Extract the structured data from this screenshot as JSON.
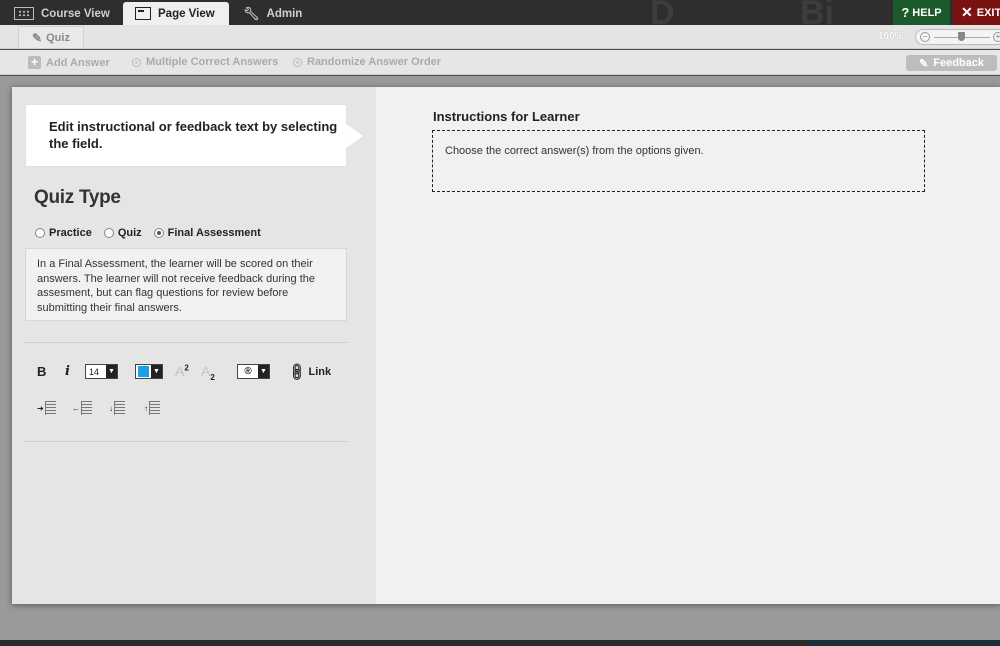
{
  "topnav": {
    "tabs": [
      {
        "label": "Course View",
        "icon": "grid-icon"
      },
      {
        "label": "Page View",
        "icon": "page-icon",
        "active": true
      },
      {
        "label": "Admin",
        "icon": "wrench-icon"
      }
    ],
    "help_label": "HELP",
    "exit_label": "EXIT",
    "help_color": "#1c5a2b",
    "exit_color": "#7a1212"
  },
  "subbar": {
    "page_tab_label": "Quiz",
    "zoom_label": "100%",
    "zoom_level_percent": 100
  },
  "toolbar": {
    "add_answer": "Add Answer",
    "multiple_correct": "Multiple Correct Answers",
    "randomize": "Randomize Answer Order",
    "feedback": "Feedback"
  },
  "editor": {
    "callout_text": "Edit instructional or feedback text by selecting the field.",
    "quiz_type_title": "Quiz Type",
    "quiz_type_options": [
      {
        "label": "Practice",
        "selected": false
      },
      {
        "label": "Quiz",
        "selected": false
      },
      {
        "label": "Final Assessment",
        "selected": true
      }
    ],
    "description": "In a Final Assessment, the learner will be scored on their answers. The learner will not receive feedback during the assesment, but can flag questions for review before submitting their final answers.",
    "format": {
      "bold": "B",
      "italic": "i",
      "font_size": "14",
      "text_color": "#1aa0e8",
      "superscript": "A",
      "superscript_mark": "2",
      "subscript": "A",
      "subscript_mark": "2",
      "symbol": "®",
      "link_label": "Link"
    }
  },
  "content": {
    "instructions_title": "Instructions for Learner",
    "instructions_text": "Choose the correct answer(s) from the options given."
  }
}
